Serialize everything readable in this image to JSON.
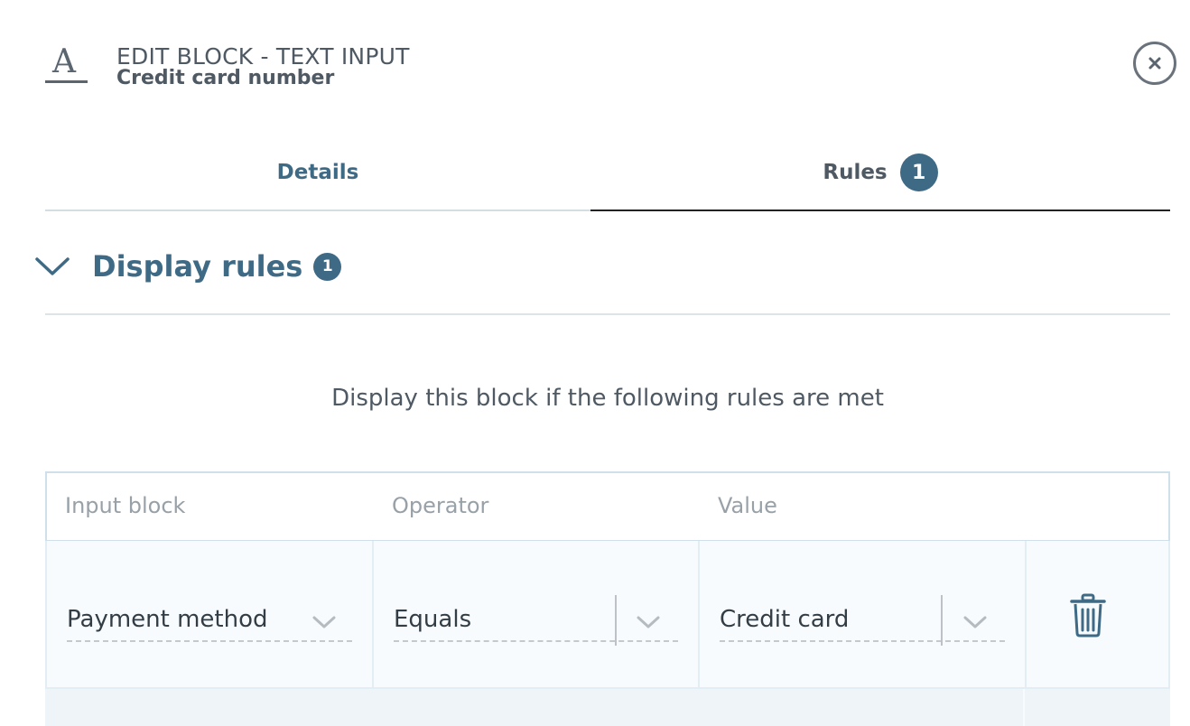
{
  "header": {
    "icon": "text-input-icon",
    "icon_glyph": "A",
    "kicker": "EDIT BLOCK - TEXT INPUT",
    "title": "Credit card number",
    "close_icon": "close-icon"
  },
  "tabs": [
    {
      "label": "Details",
      "active": false
    },
    {
      "label": "Rules",
      "active": true,
      "badge": "1"
    }
  ],
  "display_rules": {
    "title": "Display rules",
    "badge": "1",
    "expanded": true,
    "description": "Display this block if the following rules are met",
    "columns": [
      "Input block",
      "Operator",
      "Value"
    ],
    "rows": [
      {
        "input_block": "Payment method",
        "operator": "Equals",
        "value": "Credit card"
      }
    ]
  },
  "colors": {
    "accent": "#3f6a86",
    "text": "#4e5963",
    "muted": "#98a1a8",
    "row_bg": "#f8fbfd"
  }
}
